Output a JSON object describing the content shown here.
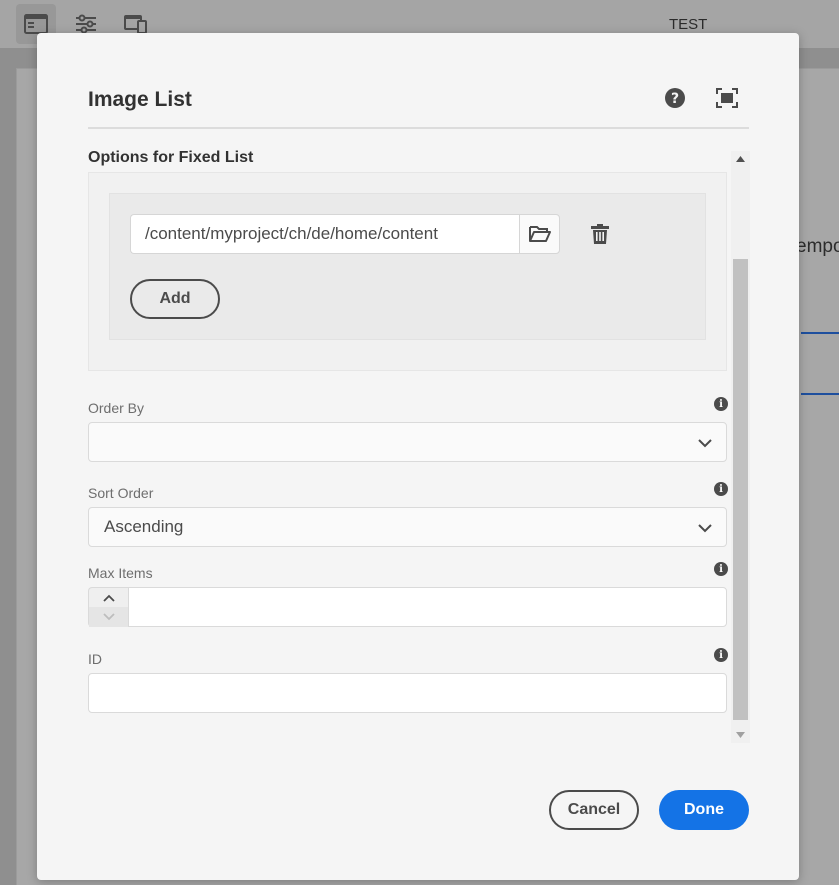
{
  "background": {
    "toolbar_title": "TEST",
    "partial_text": "empo",
    "toolbar_icons": [
      "side-panel-icon",
      "properties-icon",
      "emulator-icon"
    ]
  },
  "dialog": {
    "title": "Image List",
    "header_icons": [
      "help-icon",
      "fullscreen-icon"
    ],
    "fixed_list": {
      "section_title": "Options for Fixed List",
      "items": [
        {
          "path": "/content/myproject/ch/de/home/content"
        }
      ],
      "add_label": "Add"
    },
    "fields": {
      "order_by": {
        "label": "Order By",
        "value": ""
      },
      "sort_order": {
        "label": "Sort Order",
        "value": "Ascending"
      },
      "max_items": {
        "label": "Max Items",
        "value": ""
      },
      "id": {
        "label": "ID",
        "value": ""
      }
    },
    "footer": {
      "cancel_label": "Cancel",
      "done_label": "Done"
    },
    "colors": {
      "primary": "#1473e6",
      "text": "#4b4b4b",
      "dialog_bg": "#f5f5f5"
    }
  }
}
